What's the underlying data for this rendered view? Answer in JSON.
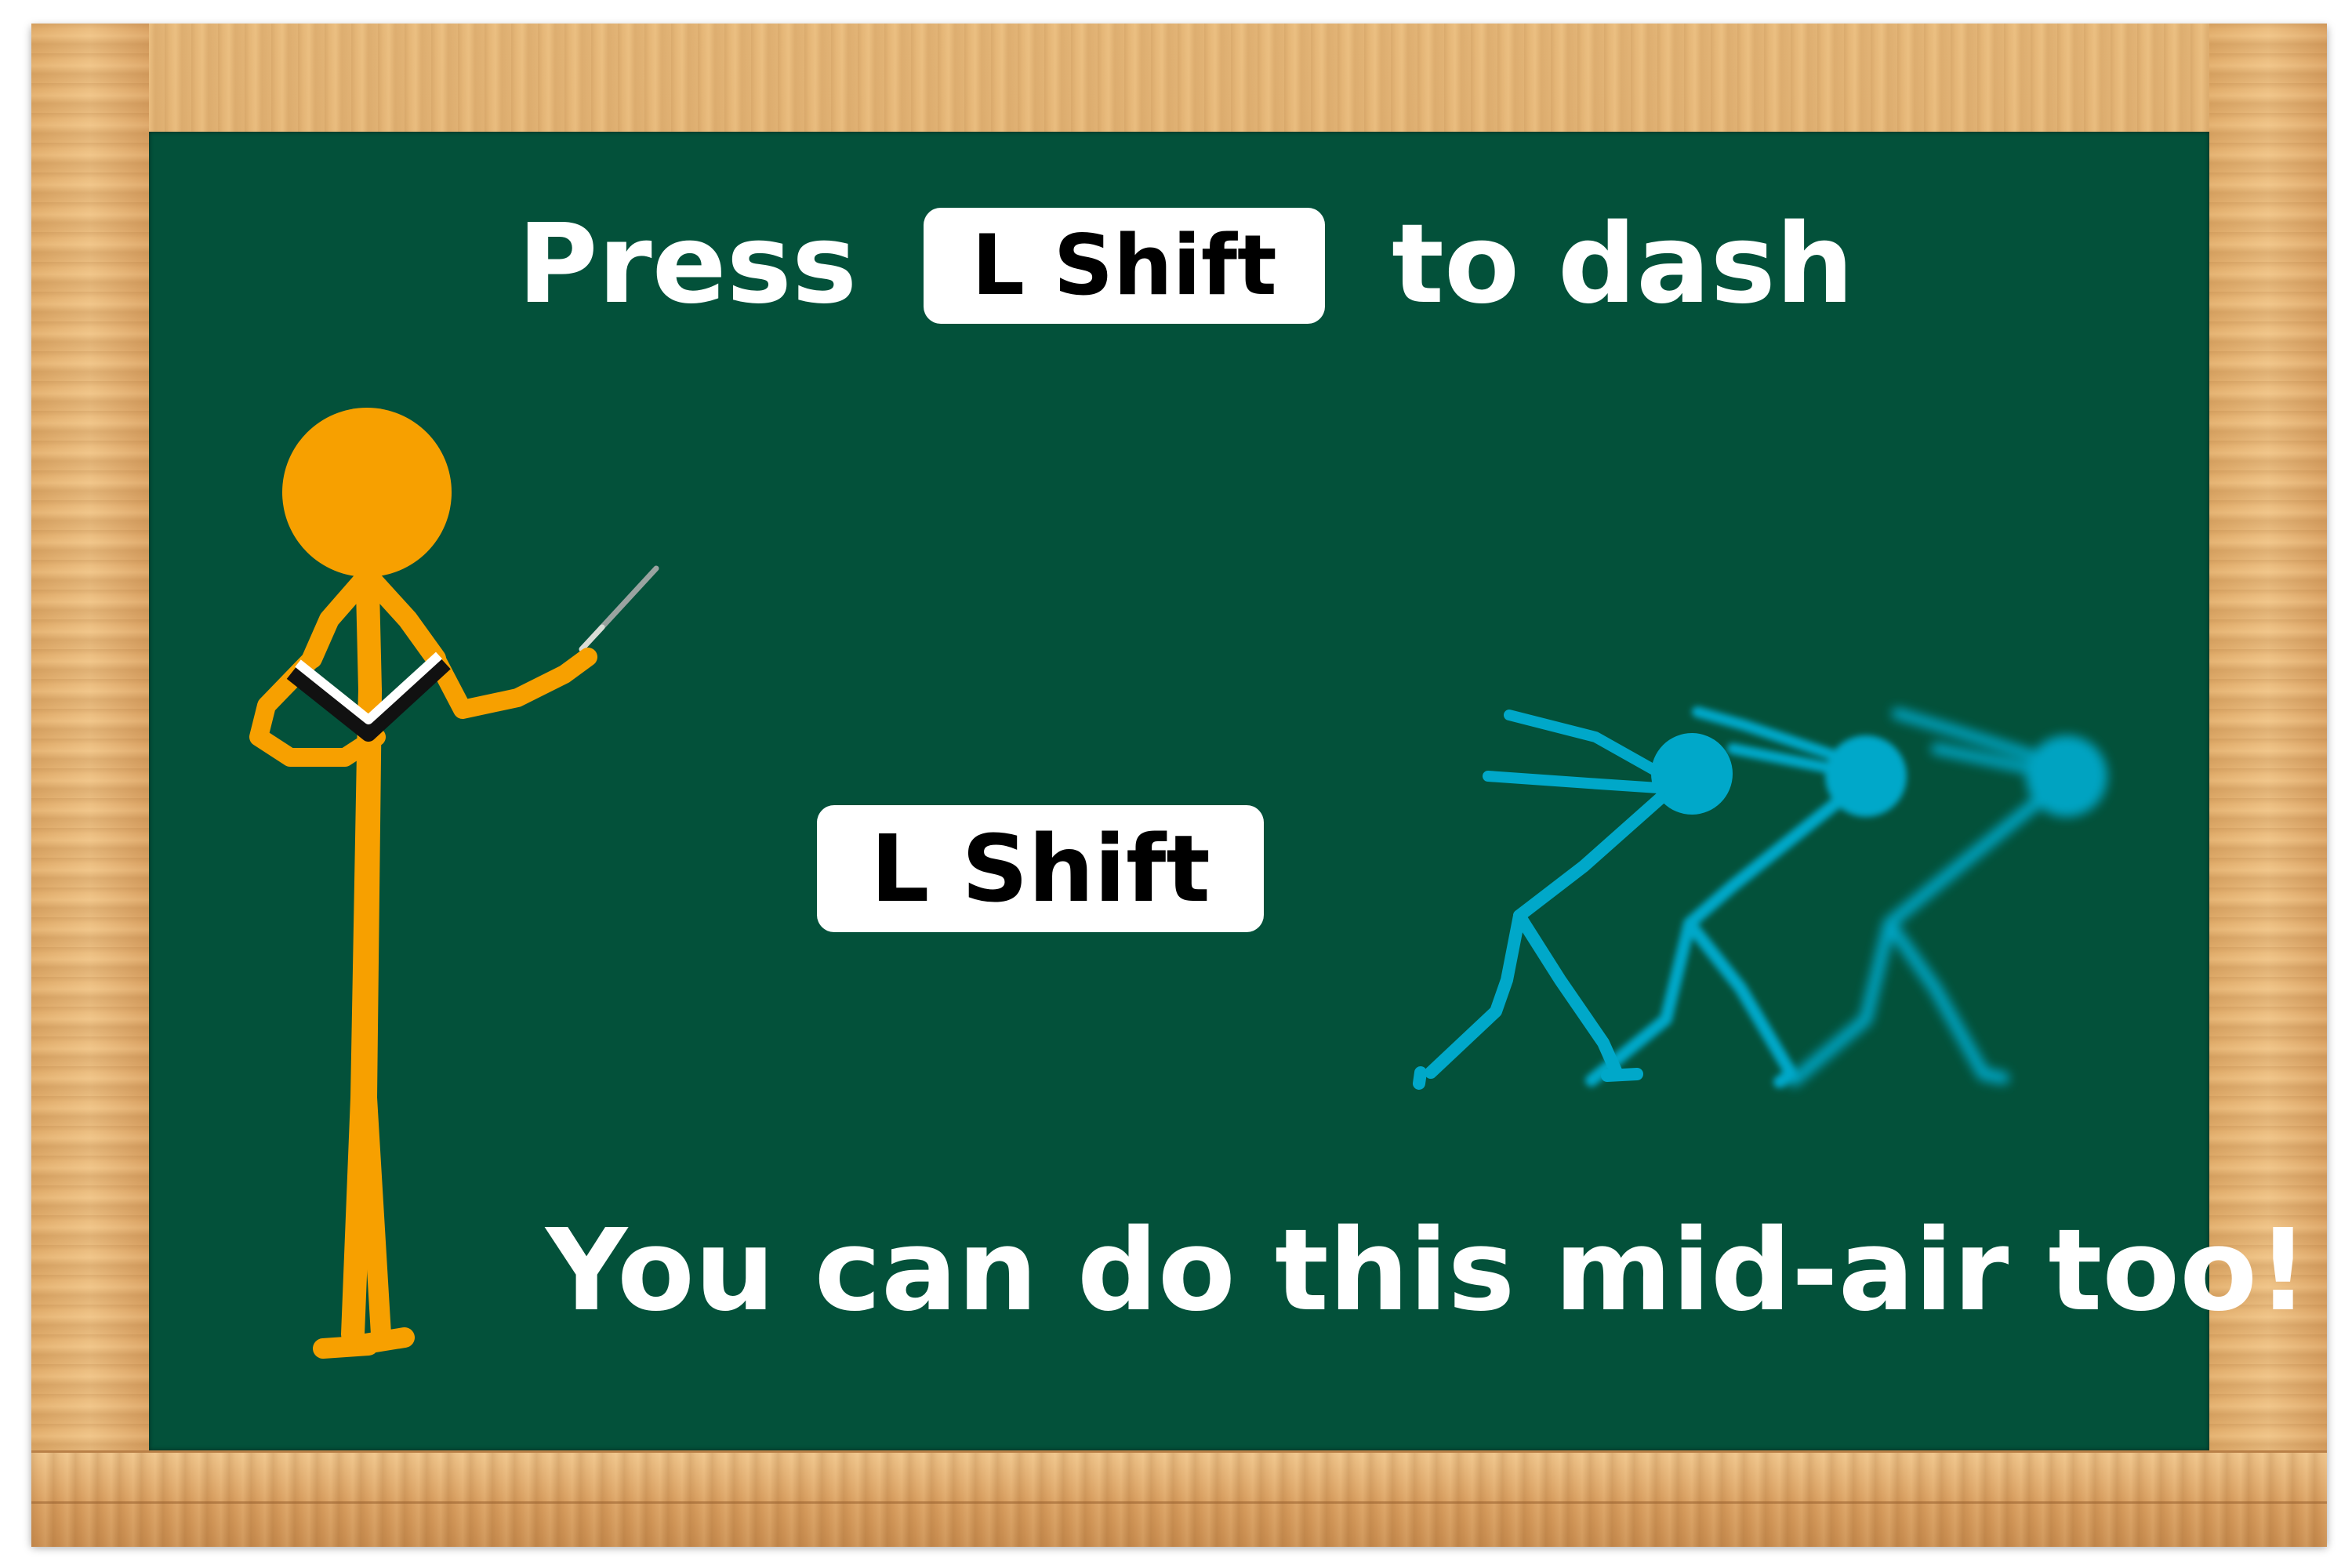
{
  "tutorial": {
    "press_word": "Press",
    "key_label": "L Shift",
    "to_dash": "to dash",
    "demo_key_label": "L Shift",
    "midair_tip": "You can do this mid-air too!"
  },
  "icons": {
    "teacher": "orange-stick-figure-teacher-icon",
    "runner": "blue-dashing-stick-figure-icon"
  },
  "colors": {
    "board": "#03513a",
    "frame_wood": "#dba565",
    "teacher": "#f7a000",
    "runner": "#00a8c9",
    "text": "#ffffff",
    "keycap": "#ffffff",
    "keycap_text": "#000000"
  }
}
